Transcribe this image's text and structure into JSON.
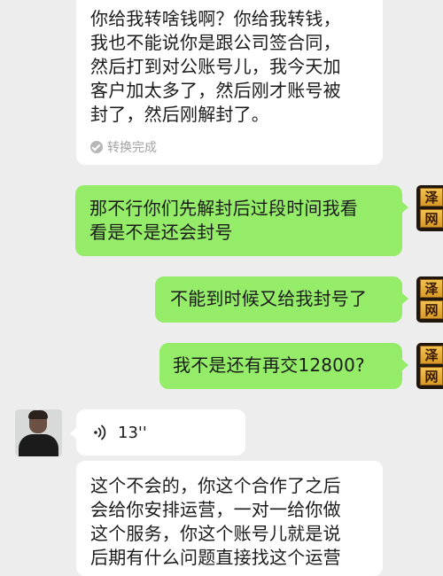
{
  "messages": [
    {
      "id": "m1",
      "direction": "incoming",
      "lines": [
        "你给我转啥钱啊？你给我转钱，",
        "我也不能说你是跟公司签合同，",
        "然后打到对公账号儿，我今天加",
        "客户加太多了，然后刚才账号被",
        "封了，然后刚解封了。"
      ],
      "status_icon": "check-circle-icon",
      "status": "转换完成"
    },
    {
      "id": "m2",
      "direction": "outgoing",
      "lines": [
        "那不行你们先解封后过段时间我看",
        "看是不是还会封号"
      ]
    },
    {
      "id": "m3",
      "direction": "outgoing",
      "lines": [
        "不能到时候又给我封号了"
      ]
    },
    {
      "id": "m4",
      "direction": "outgoing",
      "lines": [
        "我不是还有再交12800?"
      ]
    },
    {
      "id": "m5",
      "direction": "incoming",
      "type": "voice",
      "icon": "voice-wave-icon",
      "duration": "13''"
    },
    {
      "id": "m6",
      "direction": "incoming",
      "lines": [
        "这个不会的，你这个合作了之后",
        "会给你安排运营，一对一给你做",
        "这个服务，你这个账号儿就是说",
        "后期有什么问题直接找这个运营"
      ]
    }
  ],
  "self_avatar": {
    "glyphs": [
      "泽",
      "网"
    ],
    "colors": {
      "background": "#1f160d",
      "seal": "#e7b040"
    }
  },
  "colors": {
    "chat_background": "#ededed",
    "incoming_bubble": "#ffffff",
    "outgoing_bubble": "#95ec69",
    "status_text": "#a3a3a3"
  }
}
